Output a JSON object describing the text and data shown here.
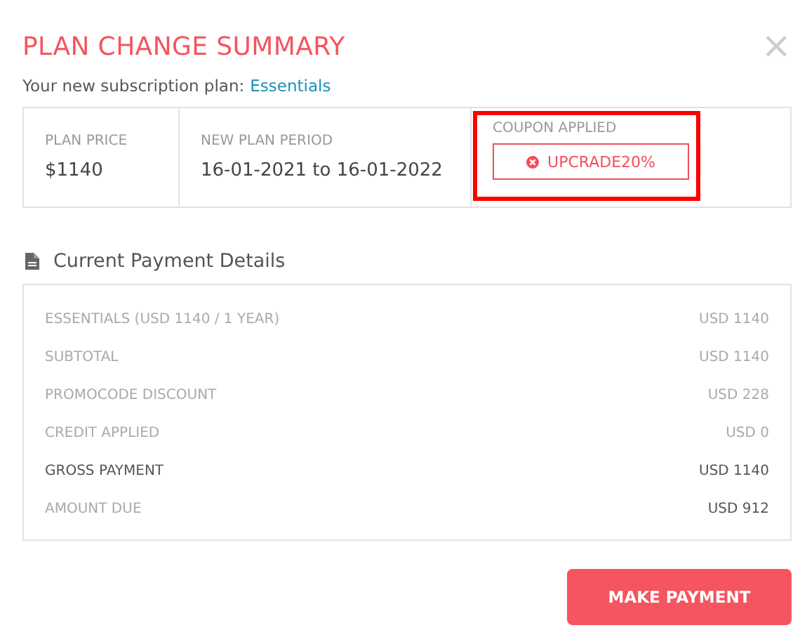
{
  "title": "PLAN CHANGE SUMMARY",
  "close": "×",
  "subtitle": {
    "text": "Your new subscription plan:",
    "plan": "Essentials"
  },
  "summary": [
    {
      "kind": "text",
      "label": "PLAN PRICE",
      "value": "$1140"
    },
    {
      "kind": "text",
      "label": "NEW PLAN PERIOD",
      "value": "16-01-2021 to 16-01-2022"
    },
    {
      "kind": "coupon",
      "label": "COUPON APPLIED",
      "value": "UPCRADE20%",
      "highlighted": true
    }
  ],
  "details": {
    "heading": "Current Payment Details",
    "rows": [
      {
        "label": "ESSENTIALS (USD 1140 / 1 YEAR)",
        "value": "USD 1140",
        "label_strong": false,
        "value_strong": false
      },
      {
        "label": "SUBTOTAL",
        "value": "USD 1140",
        "label_strong": false,
        "value_strong": false
      },
      {
        "label": "PROMOCODE DISCOUNT",
        "value": "USD 228",
        "label_strong": false,
        "value_strong": false
      },
      {
        "label": "CREDIT APPLIED",
        "value": "USD 0",
        "label_strong": false,
        "value_strong": false
      },
      {
        "label": "GROSS PAYMENT",
        "value": "USD 1140",
        "label_strong": true,
        "value_strong": true
      },
      {
        "label": "AMOUNT DUE",
        "value": "USD 912",
        "label_strong": false,
        "value_strong": true
      }
    ]
  },
  "button": "MAKE PAYMENT"
}
